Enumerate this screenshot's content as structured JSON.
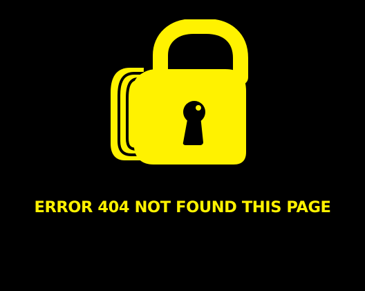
{
  "message": {
    "text": "ERROR 404 NOT FOUND THIS PAGE"
  },
  "colors": {
    "background": "#000000",
    "accent": "#FFF200"
  },
  "icons": {
    "lock": "padlock-icon",
    "keyhole": "keyhole-icon"
  }
}
